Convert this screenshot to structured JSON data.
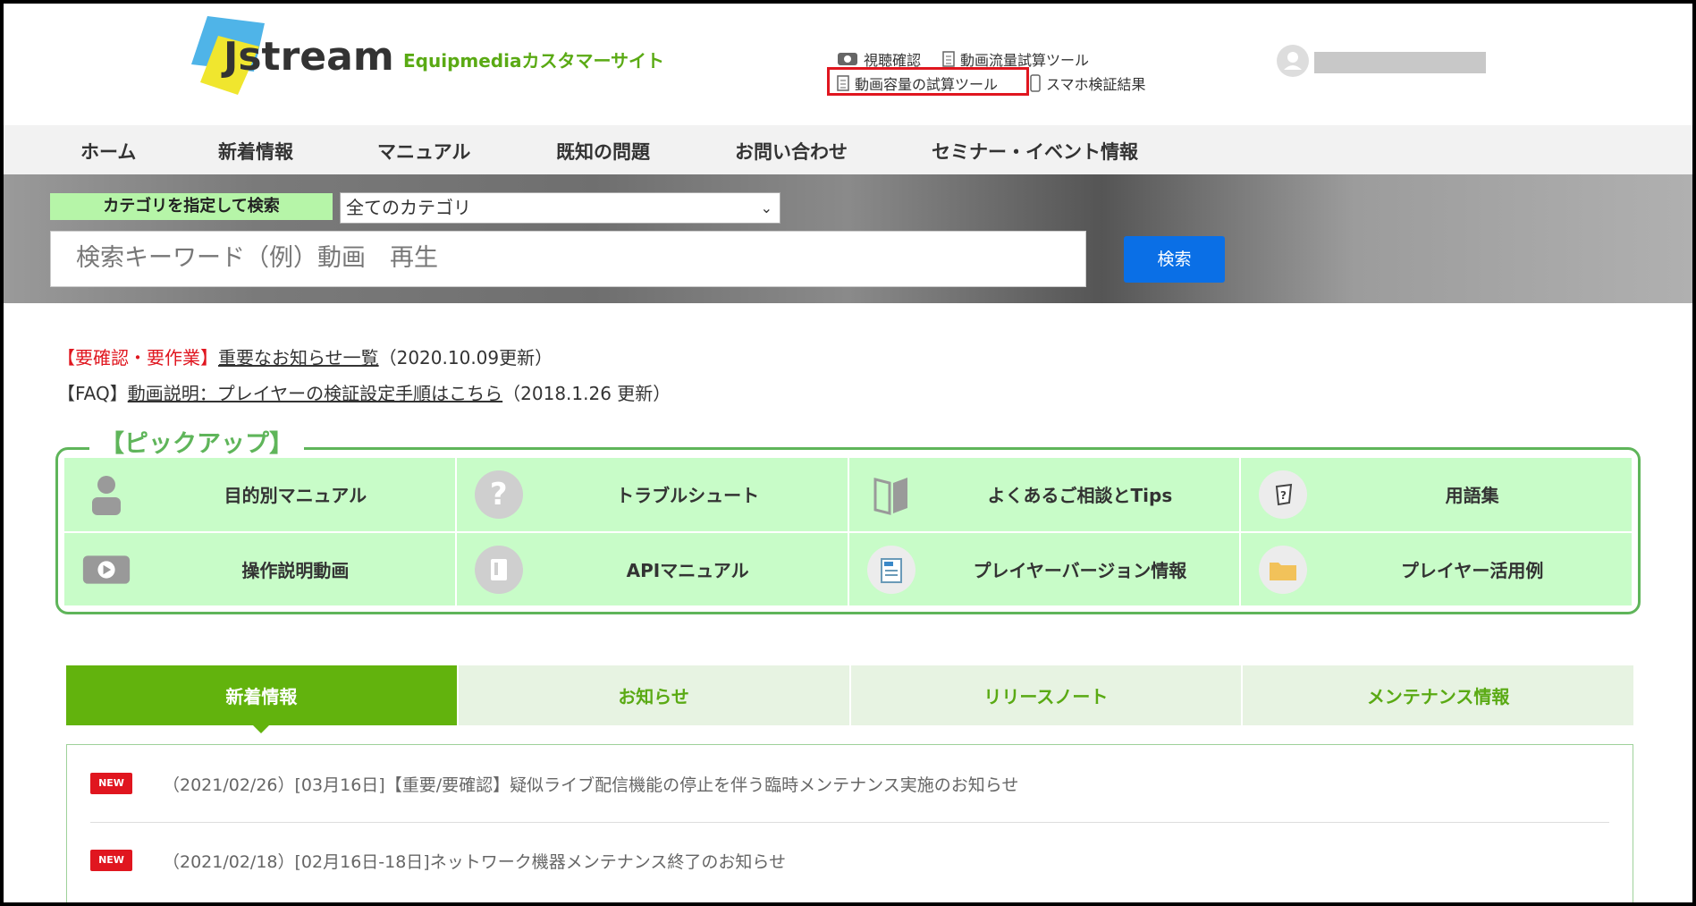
{
  "header": {
    "logo_text": "Jstream",
    "site_name": "Equipmediaカスタマーサイト",
    "links": [
      {
        "label": "視聴確認",
        "icon": "play-icon"
      },
      {
        "label": "動画流量試算ツール",
        "icon": "calculator-icon"
      },
      {
        "label": "動画容量の試算ツール",
        "icon": "calculator-icon"
      },
      {
        "label": "スマホ検証結果",
        "icon": "smartphone-icon"
      }
    ]
  },
  "nav": {
    "items": [
      "ホーム",
      "新着情報",
      "マニュアル",
      "既知の問題",
      "お問い合わせ",
      "セミナー・イベント情報"
    ]
  },
  "search": {
    "category_label": "カテゴリを指定して検索",
    "category_value": "全てのカテゴリ",
    "placeholder": "検索キーワード（例）動画　再生",
    "button": "検索"
  },
  "notices": [
    {
      "prefix": "【要確認・要作業】",
      "link": "重要なお知らせ一覧",
      "suffix": "（2020.10.09更新）"
    },
    {
      "prefix": "【FAQ】",
      "link": "動画説明：プレイヤーの検証設定手順はこちら",
      "suffix": "（2018.1.26 更新）"
    }
  ],
  "pickup": {
    "title": "【ピックアップ】",
    "items": [
      {
        "label": "目的別マニュアル",
        "icon": "person-icon"
      },
      {
        "label": "トラブルシュート",
        "icon": "question-icon"
      },
      {
        "label": "よくあるご相談とTips",
        "icon": "book-icon"
      },
      {
        "label": "用語集",
        "icon": "dictionary-icon"
      },
      {
        "label": "操作説明動画",
        "icon": "video-icon"
      },
      {
        "label": "APIマニュアル",
        "icon": "document-icon"
      },
      {
        "label": "プレイヤーバージョン情報",
        "icon": "news-icon"
      },
      {
        "label": "プレイヤー活用例",
        "icon": "folder-icon"
      }
    ]
  },
  "tabs": [
    "新着情報",
    "お知らせ",
    "リリースノート",
    "メンテナンス情報"
  ],
  "news": [
    {
      "badge": "NEW",
      "text": "（2021/02/26）[03月16日]【重要/要確認】疑似ライブ配信機能の停止を伴う臨時メンテナンス実施のお知らせ"
    },
    {
      "badge": "NEW",
      "text": "（2021/02/18）[02月16日-18日]ネットワーク機器メンテナンス終了のお知らせ"
    }
  ],
  "colors": {
    "accent_green": "#5aaa14",
    "highlight_red": "#e0161f",
    "search_blue": "#0a6fe6"
  }
}
